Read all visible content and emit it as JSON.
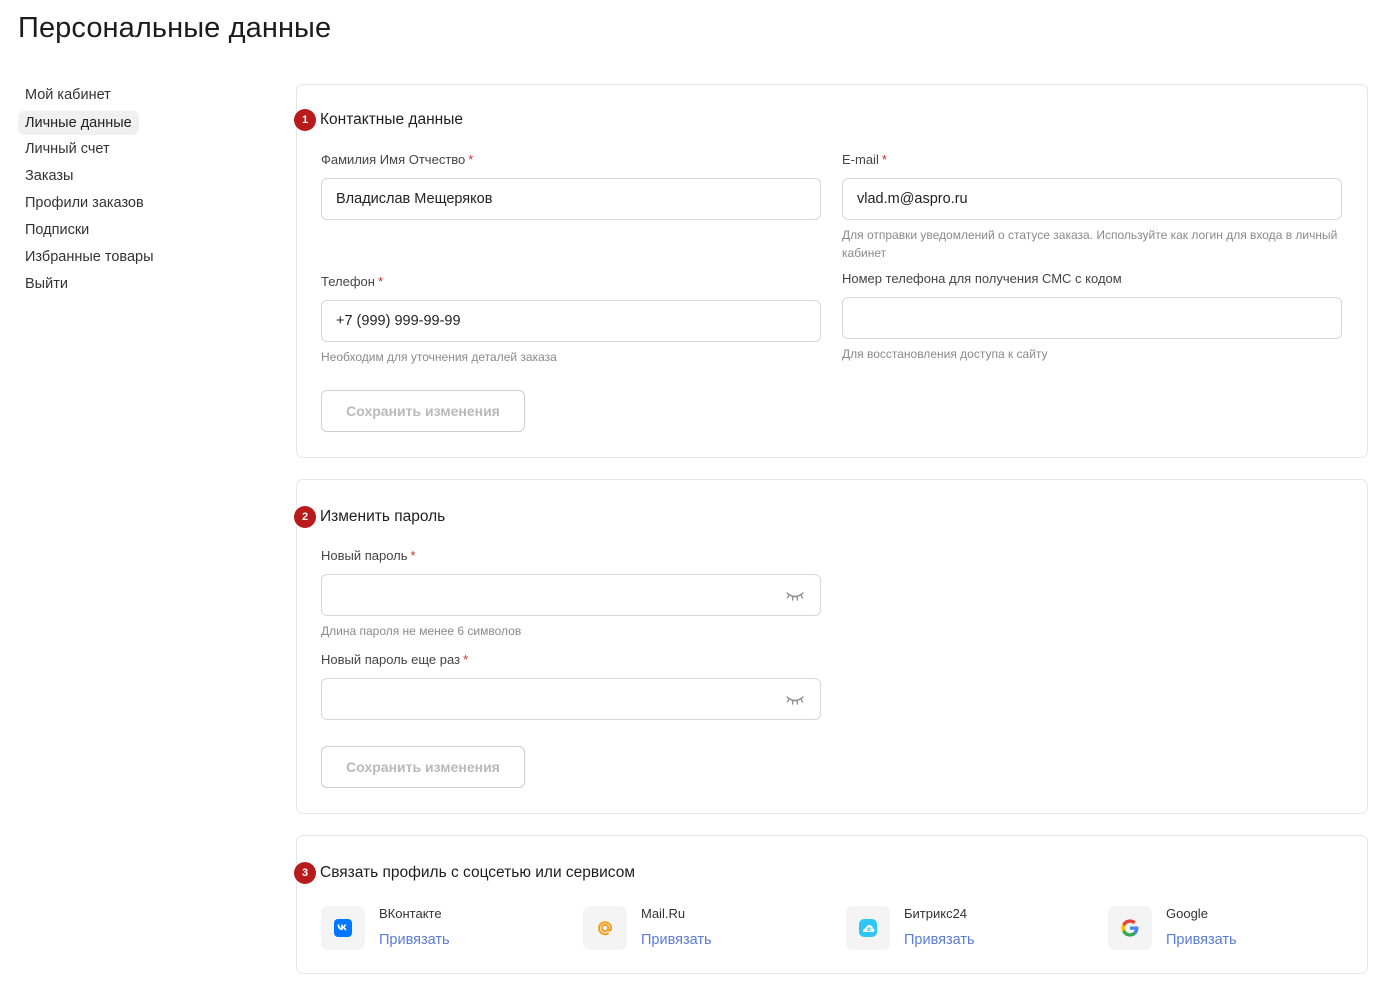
{
  "page": {
    "title": "Персональные данные"
  },
  "sidebar": {
    "items": [
      {
        "label": "Мой кабинет"
      },
      {
        "label": "Личные данные",
        "active": true
      },
      {
        "label": "Личный счет"
      },
      {
        "label": "Заказы"
      },
      {
        "label": "Профили заказов"
      },
      {
        "label": "Подписки"
      },
      {
        "label": "Избранные товары"
      },
      {
        "label": "Выйти"
      }
    ]
  },
  "contact": {
    "number": "1",
    "title": "Контактные данные",
    "fio": {
      "label": "Фамилия Имя Отчество",
      "required": "*",
      "value": "Владислав Мещеряков"
    },
    "email": {
      "label": "E-mail",
      "required": "*",
      "value": "vlad.m@aspro.ru",
      "hint": "Для отправки уведомлений о статусе заказа. Используйте как логин для входа в личный кабинет"
    },
    "phone": {
      "label": "Телефон",
      "required": "*",
      "value": "+7 (999) 999-99-99",
      "hint": "Необходим для уточнения деталей заказа"
    },
    "sms_phone": {
      "label": "Номер телефона для получения СМС с кодом",
      "value": "",
      "hint": "Для восстановления доступа к сайту"
    },
    "save_label": "Сохранить изменения"
  },
  "password": {
    "number": "2",
    "title": "Изменить пароль",
    "new": {
      "label": "Новый пароль",
      "required": "*",
      "value": "",
      "hint": "Длина пароля не менее 6 символов"
    },
    "repeat": {
      "label": "Новый пароль еще раз",
      "required": "*",
      "value": ""
    },
    "save_label": "Сохранить изменения"
  },
  "social": {
    "number": "3",
    "title": "Связать профиль с соцсетью или сервисом",
    "items": [
      {
        "name": "ВКонтакте",
        "link": "Привязать",
        "icon": "vk-icon"
      },
      {
        "name": "Mail.Ru",
        "link": "Привязать",
        "icon": "mailru-icon"
      },
      {
        "name": "Битрикс24",
        "link": "Привязать",
        "icon": "bitrix24-icon"
      },
      {
        "name": "Google",
        "link": "Привязать",
        "icon": "google-icon"
      }
    ]
  },
  "colors": {
    "accent_badge": "#b81b1b",
    "link": "#5a7bd6",
    "required": "#d0302f"
  }
}
